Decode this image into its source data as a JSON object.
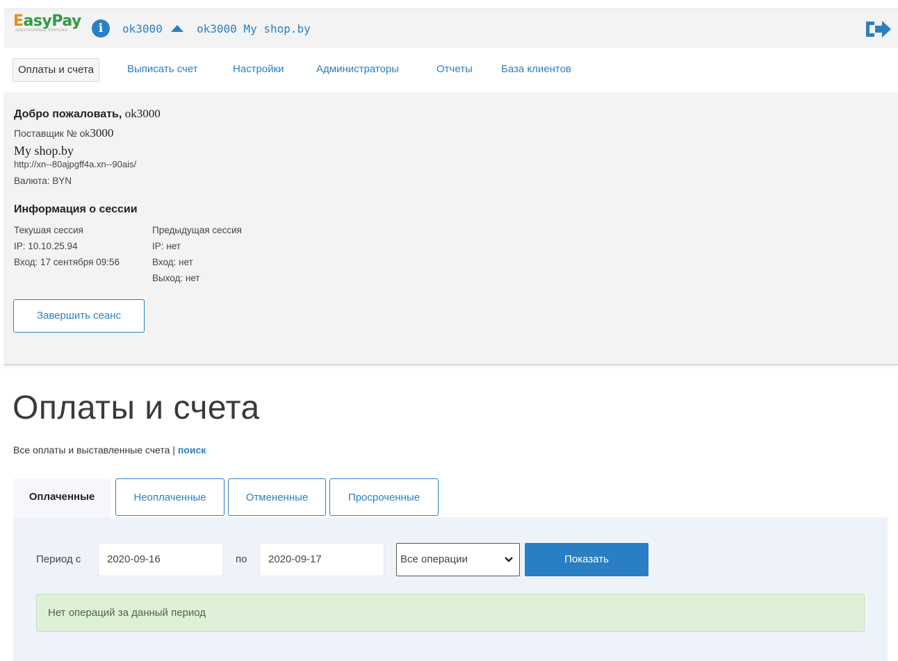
{
  "header": {
    "logo_text_1": "E",
    "logo_text_2": "asyPay",
    "logo_tagline": "ЭЛЕКТРОННЫЕ ПЛАТЕЖИ",
    "user_id": "ok3000",
    "shop_label": "ok3000 My shop.by",
    "info_icon": "info-icon",
    "logout_icon": "logout-icon"
  },
  "nav": {
    "items": [
      {
        "label": "Оплаты и счета",
        "active": true
      },
      {
        "label": "Выписать счет"
      },
      {
        "label": "Настройки"
      },
      {
        "label": "Администраторы"
      },
      {
        "label": "Отчеты"
      },
      {
        "label": "База клиентов"
      }
    ]
  },
  "account": {
    "welcome_prefix": "Добро пожаловать, ",
    "welcome_name": "ok3000",
    "supplier_prefix": "Поставщик № ok",
    "supplier_num": "3000",
    "shop_name": "My shop.by",
    "url": "http://xn--80ajpgff4a.xn--90ais/",
    "currency": "Валюта: BYN"
  },
  "session": {
    "heading": "Информация о сессии",
    "current": {
      "title": "Текушая сессия",
      "ip": "IP: 10.10.25.94",
      "login": "Вход: 17 сентября 09:56"
    },
    "previous": {
      "title": "Предыдущая сессия",
      "ip": "IP: нет",
      "login": "Вход: нет",
      "logout": "Выход: нет"
    },
    "end_button": "Завершить сеанс"
  },
  "main": {
    "title": "Оплаты и счета",
    "subtitle_text": "Все оплаты и выставленные счета | ",
    "subtitle_link": "поиск",
    "tabs": [
      {
        "label": "Оплаченные",
        "active": true
      },
      {
        "label": "Неоплаченные"
      },
      {
        "label": "Отмененные"
      },
      {
        "label": "Просроченные"
      }
    ],
    "filter": {
      "period_from_label": "Период с",
      "date_from": "2020-09-16",
      "period_to_label": "по",
      "date_to": "2020-09-17",
      "operations_select": "Все операции",
      "show_button": "Показать"
    },
    "alert": "Нет операций за данный период"
  },
  "colors": {
    "accent": "#2a7fc3",
    "panel_bg": "#f3f3f3",
    "filter_bg": "#eef3fa",
    "alert_bg": "#dff0d8"
  }
}
